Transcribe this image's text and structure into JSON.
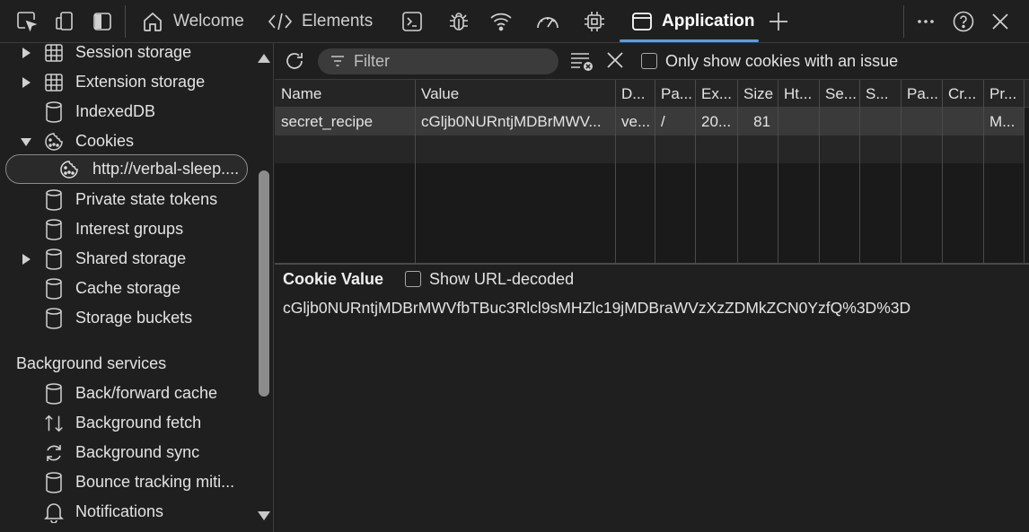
{
  "toolbar": {
    "tabs": [
      {
        "label": "Welcome",
        "icon": "home-icon"
      },
      {
        "label": "Elements",
        "icon": "code-icon"
      },
      {
        "label": "Application",
        "icon": "application-icon",
        "active": true
      }
    ]
  },
  "sidebar": {
    "items": [
      {
        "label": "Session storage",
        "icon": "table-icon",
        "expandable": true
      },
      {
        "label": "Extension storage",
        "icon": "table-icon",
        "expandable": true
      },
      {
        "label": "IndexedDB",
        "icon": "database-icon"
      },
      {
        "label": "Cookies",
        "icon": "cookie-icon",
        "expanded": true
      },
      {
        "label": "http://verbal-sleep....",
        "icon": "cookie-icon",
        "selected": true
      },
      {
        "label": "Private state tokens",
        "icon": "database-icon"
      },
      {
        "label": "Interest groups",
        "icon": "database-icon"
      },
      {
        "label": "Shared storage",
        "icon": "database-icon",
        "expandable": true
      },
      {
        "label": "Cache storage",
        "icon": "database-icon"
      },
      {
        "label": "Storage buckets",
        "icon": "database-icon"
      }
    ],
    "background_section": "Background services",
    "background_items": [
      {
        "label": "Back/forward cache",
        "icon": "database-icon"
      },
      {
        "label": "Background fetch",
        "icon": "arrows-updown-icon"
      },
      {
        "label": "Background sync",
        "icon": "sync-icon"
      },
      {
        "label": "Bounce tracking miti...",
        "icon": "database-icon"
      },
      {
        "label": "Notifications",
        "icon": "bell-icon"
      }
    ]
  },
  "filterbar": {
    "filter_placeholder": "Filter",
    "issue_checkbox_label": "Only show cookies with an issue"
  },
  "table": {
    "columns": [
      "Name",
      "Value",
      "D...",
      "Pa...",
      "Ex...",
      "Size",
      "Ht...",
      "Se...",
      "S...",
      "Pa...",
      "Cr...",
      "Pr..."
    ],
    "rows": [
      {
        "name": "secret_recipe",
        "value": "cGljb0NURntjMDBrMWV...",
        "domain": "ve...",
        "path": "/",
        "expires": "20...",
        "size": "81",
        "httponly": "",
        "secure": "",
        "samesite": "",
        "partition": "",
        "cross": "",
        "priority": "M..."
      }
    ]
  },
  "cookie_value": {
    "title": "Cookie Value",
    "show_decoded_label": "Show URL-decoded",
    "value": "cGljb0NURntjMDBrMWVfbTBuc3Rlcl9sMHZlc19jMDBraWVzXzZDMkZCN0YzfQ%3D%3D"
  }
}
